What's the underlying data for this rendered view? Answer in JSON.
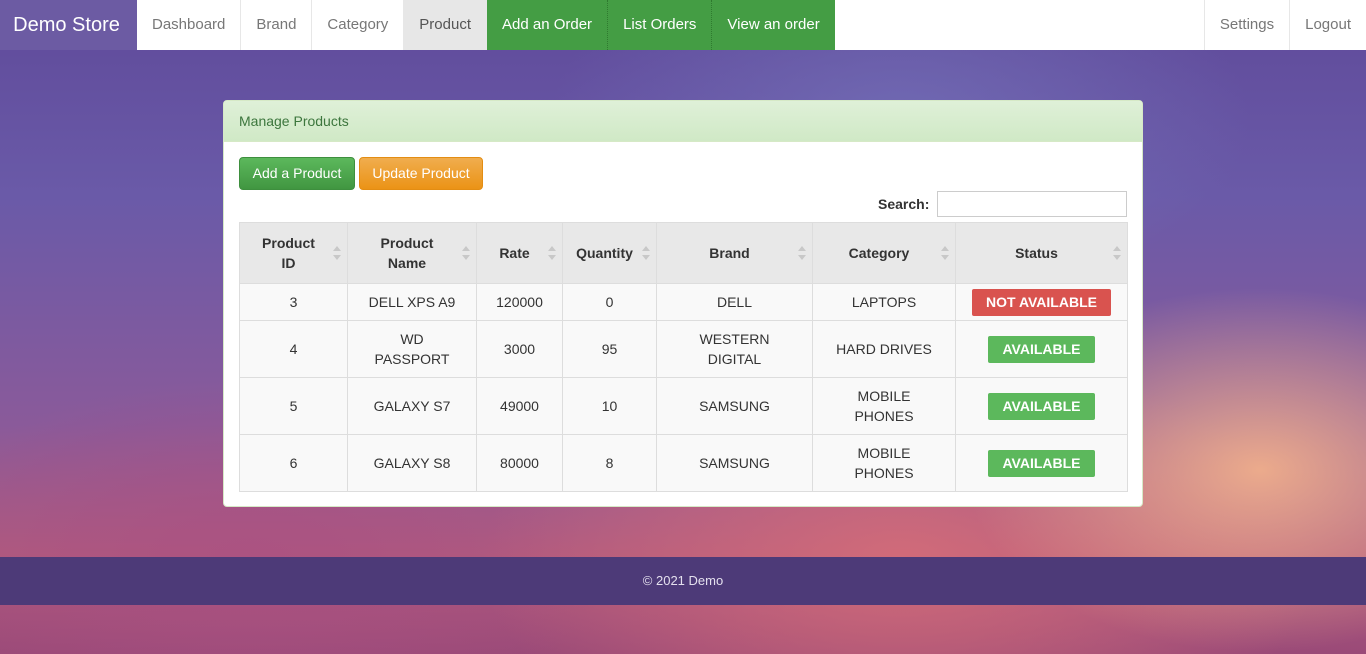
{
  "navbar": {
    "brand": "Demo Store",
    "left_items": [
      {
        "label": "Dashboard"
      },
      {
        "label": "Brand"
      },
      {
        "label": "Category"
      },
      {
        "label": "Product"
      },
      {
        "label": "Add an Order"
      },
      {
        "label": "List Orders"
      },
      {
        "label": "View an order"
      }
    ],
    "right_items": [
      {
        "label": "Settings"
      },
      {
        "label": "Logout"
      }
    ],
    "active": "Product"
  },
  "panel": {
    "title": "Manage Products",
    "add_button": "Add a Product",
    "update_button": "Update Product",
    "search_label": "Search:",
    "search_value": ""
  },
  "table": {
    "columns": [
      {
        "line1": "Product",
        "line2": "ID"
      },
      {
        "line1": "Product",
        "line2": "Name"
      },
      {
        "line1": "Rate",
        "line2": ""
      },
      {
        "line1": "Quantity",
        "line2": ""
      },
      {
        "line1": "Brand",
        "line2": ""
      },
      {
        "line1": "Category",
        "line2": ""
      },
      {
        "line1": "Status",
        "line2": ""
      }
    ],
    "rows": [
      {
        "id": "3",
        "name_1": "DELL XPS A9",
        "name_2": "",
        "rate": "120000",
        "quantity": "0",
        "brand_1": "DELL",
        "brand_2": "",
        "category_1": "LAPTOPS",
        "category_2": "",
        "status": "NOT AVAILABLE"
      },
      {
        "id": "4",
        "name_1": "WD",
        "name_2": "PASSPORT",
        "rate": "3000",
        "quantity": "95",
        "brand_1": "WESTERN",
        "brand_2": "DIGITAL",
        "category_1": "HARD DRIVES",
        "category_2": "",
        "status": "AVAILABLE"
      },
      {
        "id": "5",
        "name_1": "GALAXY S7",
        "name_2": "",
        "rate": "49000",
        "quantity": "10",
        "brand_1": "SAMSUNG",
        "brand_2": "",
        "category_1": "MOBILE",
        "category_2": "PHONES",
        "status": "AVAILABLE"
      },
      {
        "id": "6",
        "name_1": "GALAXY S8",
        "name_2": "",
        "rate": "80000",
        "quantity": "8",
        "brand_1": "SAMSUNG",
        "brand_2": "",
        "category_1": "MOBILE",
        "category_2": "PHONES",
        "status": "AVAILABLE"
      }
    ]
  },
  "footer": {
    "text": "© 2021 Demo"
  },
  "colors": {
    "brand_bg": "#6c5ba3",
    "nav_green": "#449d44",
    "available": "#5cb85c",
    "not_available": "#d9534f",
    "update_button": "#f0ad4e",
    "footer_bg": "#4d3a78"
  }
}
